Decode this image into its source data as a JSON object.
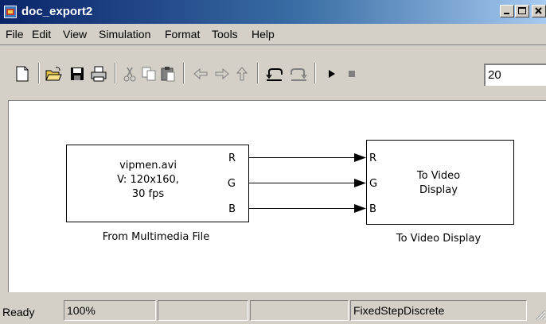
{
  "window": {
    "title": "doc_export2"
  },
  "menu": [
    "File",
    "Edit",
    "View",
    "Simulation",
    "Format",
    "Tools",
    "Help"
  ],
  "toolbar": {
    "icons": [
      "new-document-icon",
      "open-folder-icon",
      "save-icon",
      "print-icon",
      "cut-icon",
      "copy-icon",
      "paste-icon",
      "back-icon",
      "forward-icon",
      "up-icon",
      "undo-icon",
      "redo-icon",
      "play-icon",
      "stop-icon"
    ],
    "stop_time": "20"
  },
  "blocks": {
    "source": {
      "line1": "vipmen.avi",
      "line2": "V: 120x160,",
      "line3": "30 fps",
      "ports": [
        "R",
        "G",
        "B"
      ],
      "caption": "From Multimedia File"
    },
    "sink": {
      "line1": "To Video",
      "line2": "Display",
      "ports": [
        "R",
        "G",
        "B"
      ],
      "caption": "To Video Display"
    }
  },
  "status": {
    "state": "Ready",
    "zoom": "100%",
    "solver": "FixedStepDiscrete"
  }
}
